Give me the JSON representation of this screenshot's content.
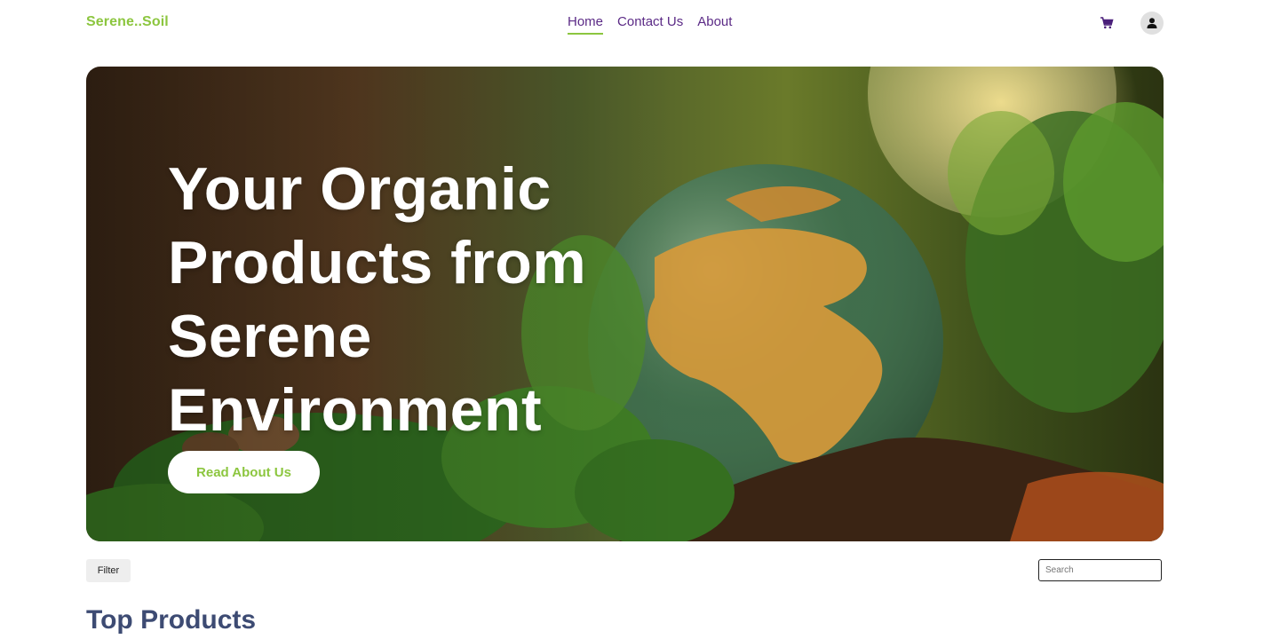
{
  "header": {
    "logo": "Serene..Soil",
    "nav": [
      {
        "label": "Home",
        "active": true
      },
      {
        "label": "Contact Us",
        "active": false
      },
      {
        "label": "About",
        "active": false
      }
    ],
    "cart_icon": "cart-icon",
    "avatar_icon": "user-icon"
  },
  "hero": {
    "title": "Your Organic Products from Serene Environment",
    "button_label": "Read About Us"
  },
  "toolbar": {
    "filter_label": "Filter",
    "search_placeholder": "Search"
  },
  "section": {
    "title": "Top Products"
  },
  "colors": {
    "brand_green": "#8cc63f",
    "nav_purple": "#5b2a86",
    "heading_navy": "#3d4b73"
  }
}
